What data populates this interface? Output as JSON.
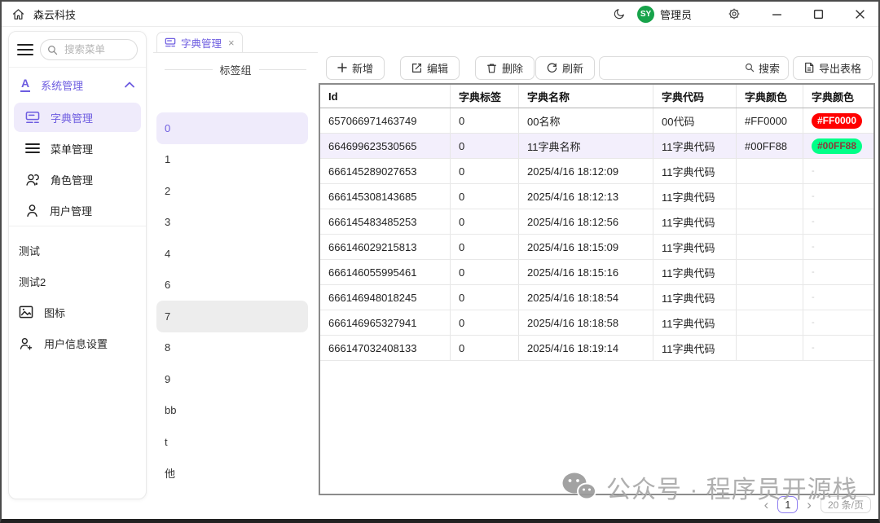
{
  "titlebar": {
    "app_title": "森云科技",
    "user_label": "管理员",
    "avatar_text": "SY"
  },
  "sidebar": {
    "search_placeholder": "搜索菜单",
    "group": {
      "label": "系统管理"
    },
    "children": [
      {
        "label": "字典管理",
        "active": true
      },
      {
        "label": "菜单管理"
      },
      {
        "label": "角色管理"
      },
      {
        "label": "用户管理"
      }
    ],
    "items": [
      {
        "label": "测试"
      },
      {
        "label": "测试2"
      },
      {
        "label": "图标"
      },
      {
        "label": "用户信息设置"
      }
    ]
  },
  "tabs": [
    {
      "label": "字典管理"
    }
  ],
  "tag_panel": {
    "title": "标签组",
    "items": [
      "0",
      "1",
      "2",
      "3",
      "4",
      "6",
      "7",
      "8",
      "9",
      "bb",
      "t",
      "他"
    ],
    "active_index": 0,
    "hover_index": 6
  },
  "toolbar": {
    "add_label": "新增",
    "edit_label": "编辑",
    "delete_label": "删除",
    "refresh_label": "刷新",
    "search_label": "搜索",
    "export_label": "导出表格",
    "search_value": ""
  },
  "table": {
    "columns": [
      "Id",
      "字典标签",
      "字典名称",
      "字典代码",
      "字典颜色",
      "字典颜色"
    ],
    "selected_row_index": 1,
    "badge_text_colors": {
      "#FF0000": "#ffffff",
      "#00FF88": "#8b3a3a"
    },
    "rows": [
      {
        "id": "657066971463749",
        "label": "0",
        "name": "00名称",
        "code": "00代码",
        "color": "#FF0000",
        "badge": "#FF0000"
      },
      {
        "id": "664699623530565",
        "label": "0",
        "name": "11字典名称",
        "code": "11字典代码",
        "color": "#00FF88",
        "badge": "#00FF88"
      },
      {
        "id": "666145289027653",
        "label": "0",
        "name": "2025/4/16 18:12:09",
        "code": "11字典代码",
        "color": "",
        "badge": "-"
      },
      {
        "id": "666145308143685",
        "label": "0",
        "name": "2025/4/16 18:12:13",
        "code": "11字典代码",
        "color": "",
        "badge": "-"
      },
      {
        "id": "666145483485253",
        "label": "0",
        "name": "2025/4/16 18:12:56",
        "code": "11字典代码",
        "color": "",
        "badge": "-"
      },
      {
        "id": "666146029215813",
        "label": "0",
        "name": "2025/4/16 18:15:09",
        "code": "11字典代码",
        "color": "",
        "badge": "-"
      },
      {
        "id": "666146055995461",
        "label": "0",
        "name": "2025/4/16 18:15:16",
        "code": "11字典代码",
        "color": "",
        "badge": "-"
      },
      {
        "id": "666146948018245",
        "label": "0",
        "name": "2025/4/16 18:18:54",
        "code": "11字典代码",
        "color": "",
        "badge": "-"
      },
      {
        "id": "666146965327941",
        "label": "0",
        "name": "2025/4/16 18:18:58",
        "code": "11字典代码",
        "color": "",
        "badge": "-"
      },
      {
        "id": "666147032408133",
        "label": "0",
        "name": "2025/4/16 18:19:14",
        "code": "11字典代码",
        "color": "",
        "badge": "-"
      }
    ]
  },
  "pagination": {
    "current_page": "1",
    "page_size": "20 条/页"
  },
  "watermark": {
    "text": "公众号 · 程序员开源栈"
  },
  "icons": {
    "system_group_glyph": "A",
    "tab_close": "×",
    "prev_page": "‹",
    "next_page": "›"
  },
  "colors": {
    "accent": "#6d5ce0",
    "accent_bg": "#efebfb",
    "avatar_bg": "#17a34a",
    "badge_red": "#FF0000",
    "badge_green": "#00FF88",
    "selected_row_bg": "#f3effc"
  }
}
